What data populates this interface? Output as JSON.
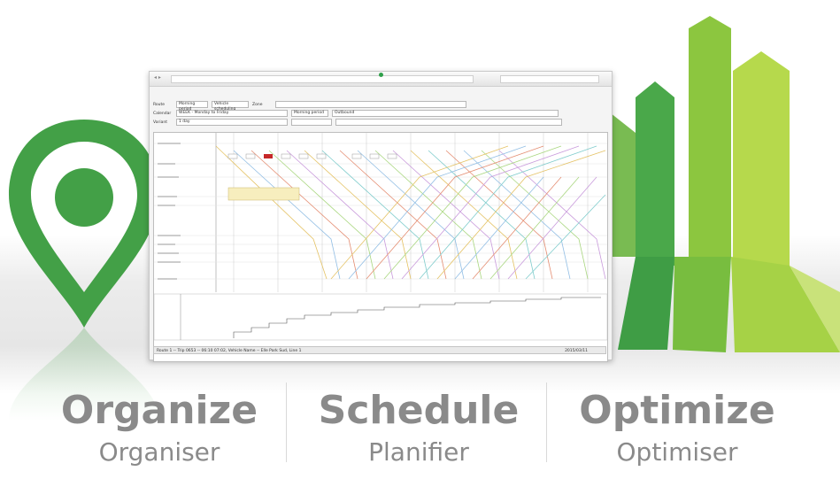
{
  "colors": {
    "brand_green": "#43a047",
    "light_green": "#b6d94c",
    "mid_green": "#7cbf3f",
    "caption_grey": "#8a8a8a"
  },
  "icons": [
    "map-pin-icon",
    "bar-chart-icon"
  ],
  "app": {
    "toolbar": {
      "row1": {
        "label": "Route",
        "f1": "Morning period",
        "f2": "Vehicle scheduling",
        "f3_label": "Zone"
      },
      "row2": {
        "label": "Calendar",
        "f1": "WEEK - Monday to Friday",
        "f2": "Morning period",
        "f3": "Outbound"
      },
      "row3": {
        "label": "Variant",
        "f1": "1 day"
      }
    },
    "status_text": "Route 1 -- Trip 0653 -- 06:10 07:02, Vehicle Name -- Elle Park Sud, Line 1",
    "status_right": "2015/03/11"
  },
  "captions": [
    {
      "title": "Organize",
      "subtitle": "Organiser"
    },
    {
      "title": "Schedule",
      "subtitle": "Planifier"
    },
    {
      "title": "Optimize",
      "subtitle": "Optimiser"
    }
  ]
}
